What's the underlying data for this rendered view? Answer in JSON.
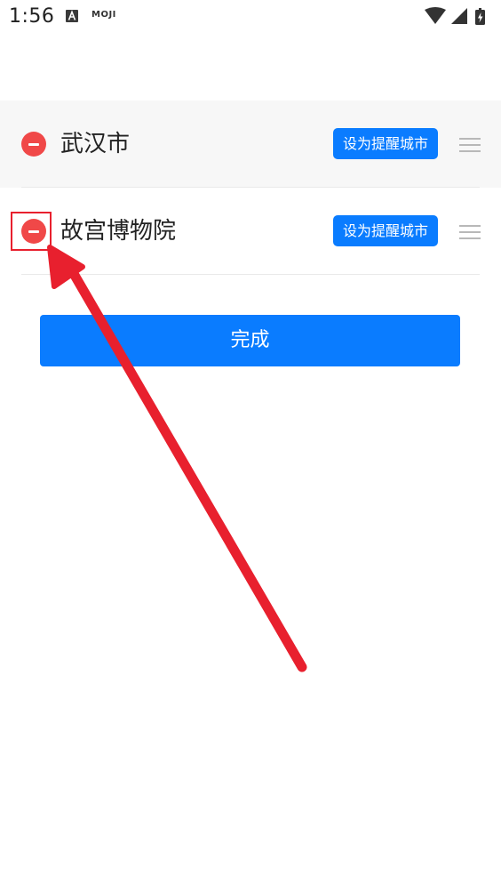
{
  "status_bar": {
    "time": "1:56",
    "notifications": [
      "A",
      "MOJI"
    ]
  },
  "cities": [
    {
      "name": "武汉市",
      "action_label": "设为提醒城市"
    },
    {
      "name": "故宫博物院",
      "action_label": "设为提醒城市"
    }
  ],
  "done_label": "完成",
  "colors": {
    "accent": "#0a7cff",
    "remove": "#f04848",
    "annotation": "#e8202e"
  }
}
